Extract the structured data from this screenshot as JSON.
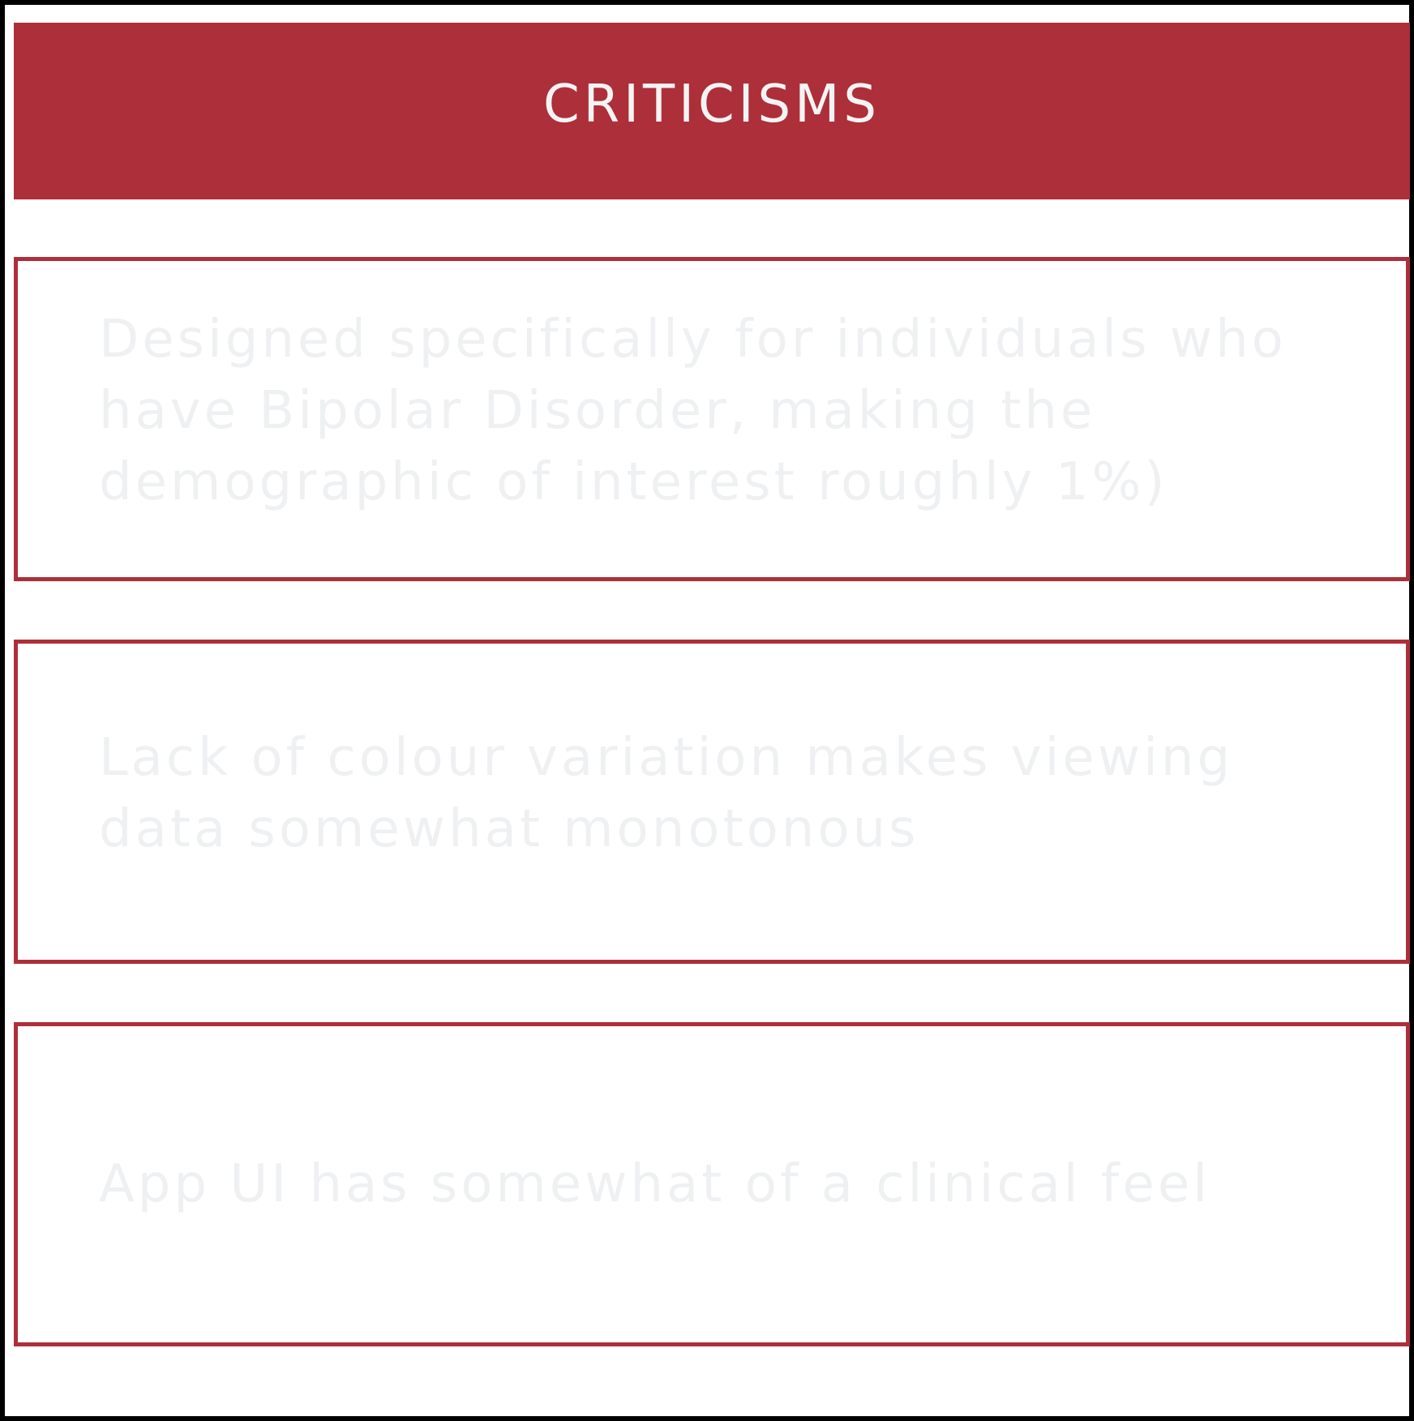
{
  "header": {
    "title": "CRITICISMS"
  },
  "criticisms": [
    {
      "text": "Designed specifically for individuals who have Bipolar Disorder, making the demographic of interest roughly 1%)"
    },
    {
      "text": "Lack of colour variation makes viewing data somewhat monotonous"
    },
    {
      "text": "App UI has somewhat of a clinical feel"
    }
  ],
  "colors": {
    "accent": "#ad2f39",
    "header_text": "#f4f4f4",
    "card_text": "#eef0f2",
    "frame_border": "#000000",
    "background": "#ffffff"
  }
}
